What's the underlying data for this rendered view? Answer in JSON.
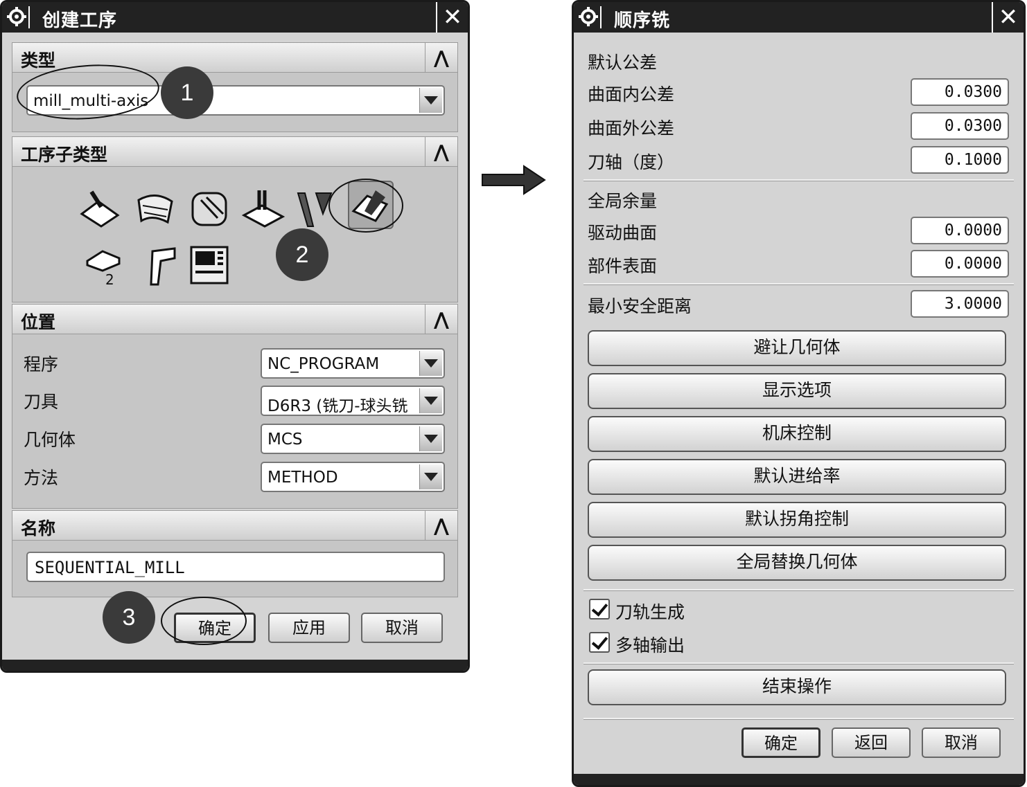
{
  "left": {
    "title": "创建工序",
    "type_section": {
      "label": "类型",
      "value": "mill_multi-axis"
    },
    "subtype_section": {
      "label": "工序子类型"
    },
    "location_section": {
      "label": "位置",
      "fields": [
        {
          "label": "程序",
          "value": "NC_PROGRAM"
        },
        {
          "label": "刀具",
          "value": "D6R3 (铣刀-球头铣"
        },
        {
          "label": "几何体",
          "value": "MCS"
        },
        {
          "label": "方法",
          "value": "METHOD"
        }
      ]
    },
    "name_section": {
      "label": "名称",
      "value": "SEQUENTIAL_MILL"
    },
    "buttons": {
      "ok": "确定",
      "apply": "应用",
      "cancel": "取消"
    }
  },
  "right": {
    "title": "顺序铣",
    "default_tol_label": "默认公差",
    "tolerances": [
      {
        "label": "曲面内公差",
        "value": "0.0300"
      },
      {
        "label": "曲面外公差",
        "value": "0.0300"
      },
      {
        "label": "刀轴（度）",
        "value": "0.1000"
      }
    ],
    "global_stock_label": "全局余量",
    "stock": [
      {
        "label": "驱动曲面",
        "value": "0.0000"
      },
      {
        "label": "部件表面",
        "value": "0.0000"
      }
    ],
    "min_clearance": {
      "label": "最小安全距离",
      "value": "3.0000"
    },
    "wide_buttons": [
      "避让几何体",
      "显示选项",
      "机床控制",
      "默认进给率",
      "默认拐角控制",
      "全局替换几何体"
    ],
    "checkboxes": [
      {
        "label": "刀轨生成",
        "checked": true
      },
      {
        "label": "多轴输出",
        "checked": true
      }
    ],
    "end_button": "结束操作",
    "buttons": {
      "ok": "确定",
      "back": "返回",
      "cancel": "取消"
    }
  },
  "callouts": [
    "1",
    "2",
    "3"
  ]
}
